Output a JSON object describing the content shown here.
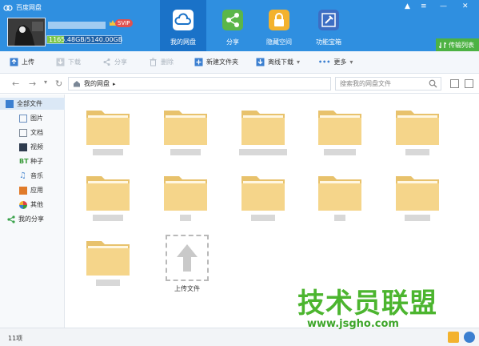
{
  "app": {
    "title": "百度网盘"
  },
  "account": {
    "quota_text": "1165.48GB/5140.00GB",
    "quota_fraction": 0.227,
    "badge": "SVIP"
  },
  "nav": [
    {
      "label": "我的网盘",
      "icon": "cloud-icon",
      "active": true
    },
    {
      "label": "分享",
      "icon": "share-icon"
    },
    {
      "label": "隐藏空间",
      "icon": "lock-icon"
    },
    {
      "label": "功能宝箱",
      "icon": "toolbox-icon"
    }
  ],
  "window_controls": {
    "notify": "▲",
    "menu": "≡",
    "minimize": "—",
    "close": "✕"
  },
  "transfer_button": "传输列表",
  "toolbar": {
    "upload": "上传",
    "download": "下载",
    "share": "分享",
    "delete": "删除",
    "new_folder": "新建文件夹",
    "offline_download": "离线下载",
    "more": "更多"
  },
  "address": {
    "path": "我的网盘",
    "search_placeholder": "搜索我的网盘文件"
  },
  "sidebar": {
    "items": [
      {
        "label": "全部文件",
        "icon": "folder-icon",
        "color": "#3b7fd0"
      },
      {
        "label": "图片",
        "icon": "image-icon",
        "color": "#6a8fbf"
      },
      {
        "label": "文档",
        "icon": "document-icon",
        "color": "#7e8a99"
      },
      {
        "label": "视频",
        "icon": "video-icon",
        "color": "#2e3b4e"
      },
      {
        "label": "种子",
        "icon": "bt-icon",
        "color": "#3a9b3a",
        "glyph": "BT"
      },
      {
        "label": "音乐",
        "icon": "music-icon",
        "color": "#4a88d0"
      },
      {
        "label": "应用",
        "icon": "app-icon",
        "color": "#e07b2a"
      },
      {
        "label": "其他",
        "icon": "other-icon",
        "color": "#d44"
      },
      {
        "label": "我的分享",
        "icon": "share-icon",
        "color": "#3aa24b"
      }
    ]
  },
  "main": {
    "folder_count": 11,
    "upload_label": "上传文件"
  },
  "status": {
    "count": "11项"
  },
  "watermark": {
    "text": "技术员联盟",
    "url": "www.jsgho.com"
  },
  "colors": {
    "header": "#2f8fe0",
    "nav_active": "#1a72c8",
    "folder": "#f5d58a",
    "watermark": "#4cb52f"
  }
}
